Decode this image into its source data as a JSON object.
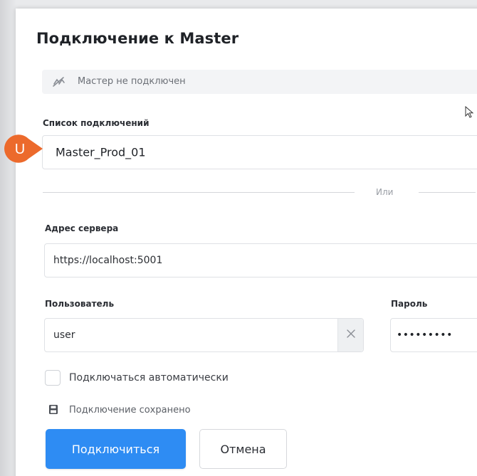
{
  "dialog": {
    "title": "Подключение к Master",
    "status": {
      "icon": "link-off-icon",
      "text": "Мастер не подключен"
    },
    "connections": {
      "label": "Список подключений",
      "selected": "Master_Prod_01"
    },
    "divider_text": "Или",
    "server": {
      "label": "Адрес сервера",
      "value": "https://localhost:5001"
    },
    "user": {
      "label": "Пользователь",
      "value": "user"
    },
    "password": {
      "label": "Пароль",
      "value": "•••••••••"
    },
    "auto_connect": {
      "label": "Подключаться автоматически",
      "checked": false
    },
    "saved_status": {
      "icon": "save-icon",
      "text": "Подключение сохранено"
    },
    "buttons": {
      "connect": "Подключиться",
      "cancel": "Отмена"
    }
  },
  "user_marker": {
    "letter": "U",
    "color": "#ec6a2c"
  },
  "colors": {
    "accent": "#2e8cf3",
    "marker": "#ec6a2c"
  }
}
